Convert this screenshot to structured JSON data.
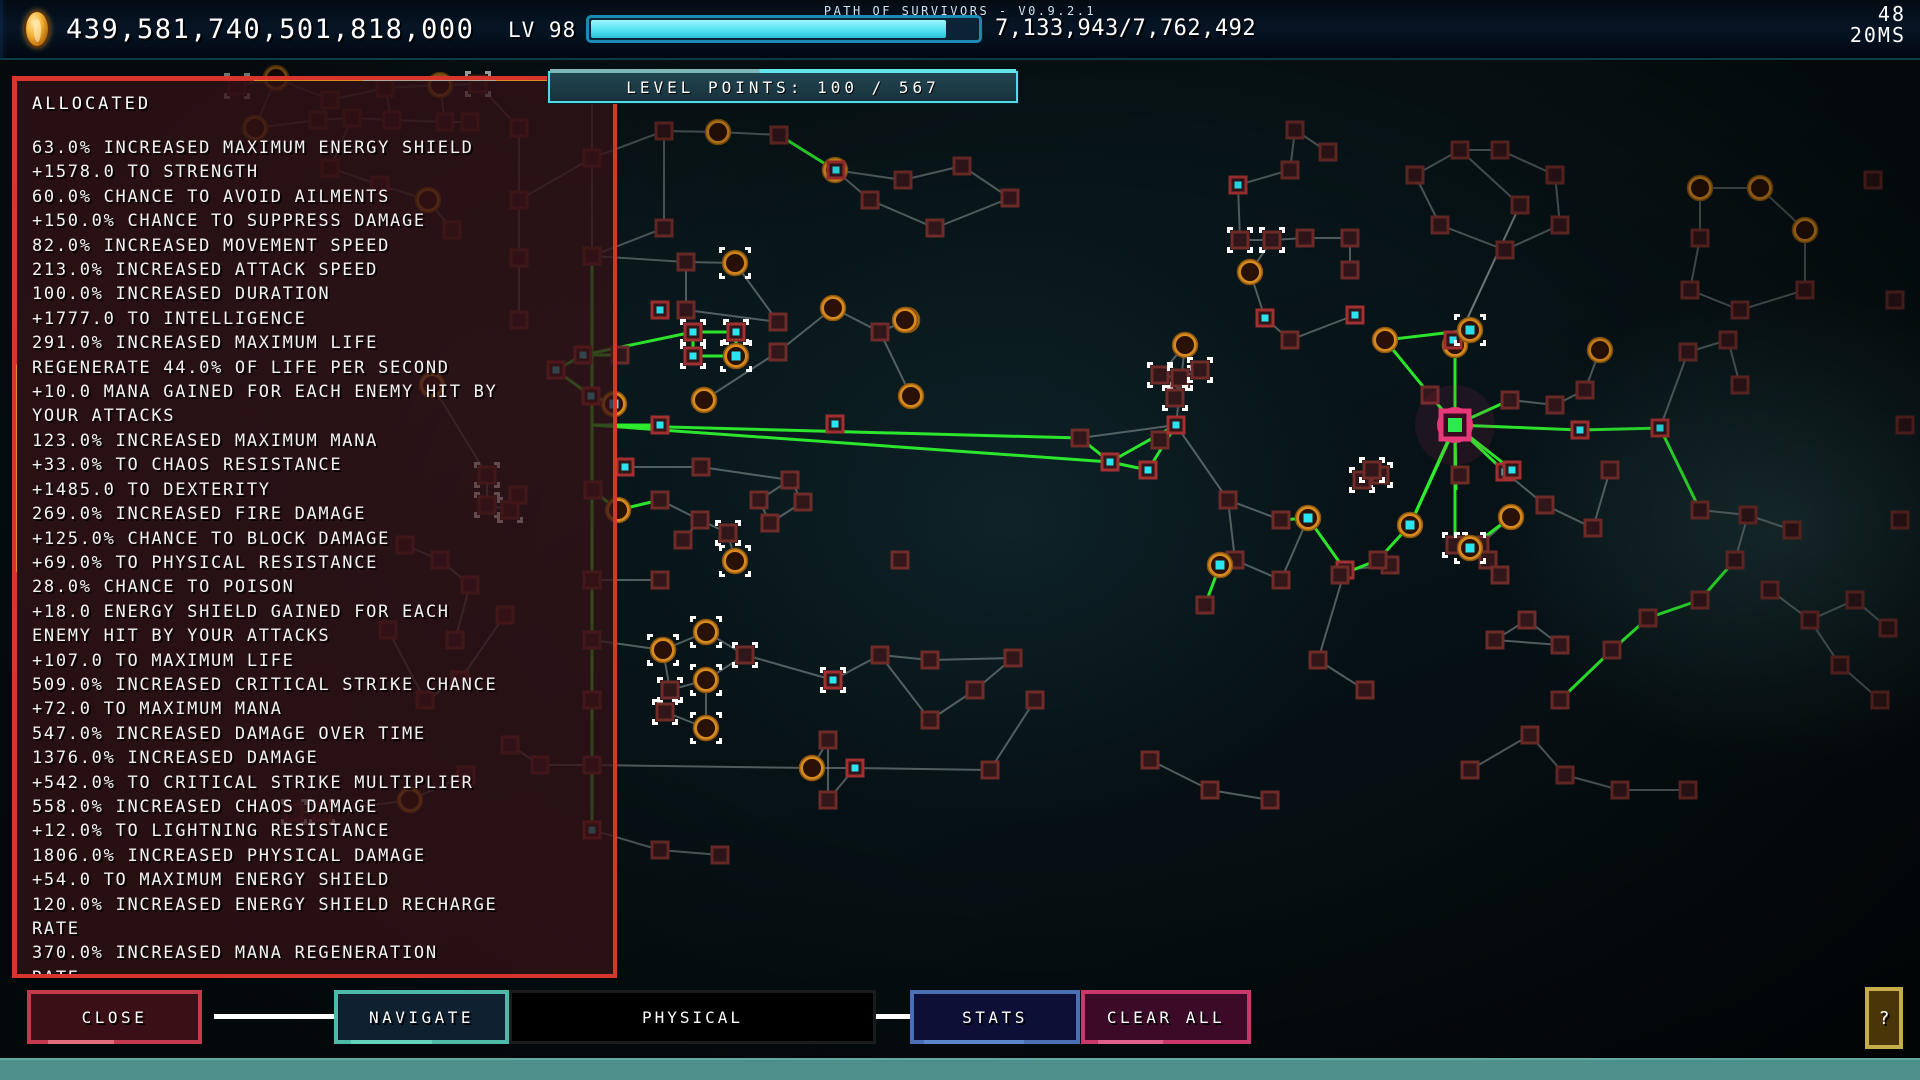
{
  "topbar": {
    "game_title": "PATH OF SURVIVORS - V0.9.2.1",
    "coin_icon": "gold-coin-icon",
    "currency_value": "439,581,740,501,818,000",
    "level_label": "LV 98",
    "xp_current": "7,133,943",
    "xp_max": "7,762,492",
    "xp_text": "7,133,943/7,762,492",
    "xp_percent": 92,
    "fps_value": "48",
    "fps_latency": "20MS"
  },
  "level_points": {
    "text": "LEVEL POINTS: 100 / 567",
    "spent": 100,
    "total": 567
  },
  "allocated_panel": {
    "title": "ALLOCATED",
    "border_color": "#d8352c",
    "stats": [
      "63.0% INCREASED MAXIMUM ENERGY SHIELD",
      "+1578.0 TO STRENGTH",
      "60.0% CHANCE TO AVOID AILMENTS",
      "+150.0% CHANCE TO SUPPRESS DAMAGE",
      "82.0% INCREASED MOVEMENT SPEED",
      "213.0% INCREASED ATTACK SPEED",
      "100.0% INCREASED DURATION",
      "+1777.0 TO INTELLIGENCE",
      "291.0% INCREASED MAXIMUM LIFE",
      "REGENERATE 44.0% OF LIFE PER SECOND",
      "+10.0 MANA GAINED FOR EACH ENEMY HIT BY",
      "YOUR ATTACKS",
      "123.0% INCREASED MAXIMUM MANA",
      "+33.0% TO CHAOS RESISTANCE",
      "+1485.0 TO DEXTERITY",
      "269.0% INCREASED FIRE DAMAGE",
      "+125.0% CHANCE TO BLOCK DAMAGE",
      "+69.0% TO PHYSICAL RESISTANCE",
      "28.0% CHANCE TO POISON",
      "+18.0 ENERGY SHIELD GAINED FOR EACH",
      "ENEMY HIT BY YOUR ATTACKS",
      "+107.0 TO MAXIMUM LIFE",
      "509.0% INCREASED CRITICAL STRIKE CHANCE",
      "+72.0 TO MAXIMUM MANA",
      "547.0% INCREASED DAMAGE OVER TIME",
      "1376.0% INCREASED DAMAGE",
      "+542.0% TO CRITICAL STRIKE MULTIPLIER",
      "558.0% INCREASED CHAOS DAMAGE",
      "+12.0% TO LIGHTNING RESISTANCE",
      "1806.0% INCREASED PHYSICAL DAMAGE",
      "+54.0 TO MAXIMUM ENERGY SHIELD",
      "120.0% INCREASED ENERGY SHIELD RECHARGE",
      "RATE",
      "370.0% INCREASED MANA REGENERATION",
      "RATE"
    ]
  },
  "toolbar": {
    "close_label": "CLOSE",
    "navigate_label": "NAVIGATE",
    "search_value": "PHYSICAL",
    "stats_label": "STATS",
    "clear_all_label": "CLEAR ALL",
    "help_label": "?"
  },
  "colors": {
    "allocated_link": "#2ef02e",
    "unallocated_link": "#8f9a9a",
    "allocated_node_fill": "#2ae4f0",
    "node_frame": "#7a2a28",
    "notable_ring": "#d6891e",
    "highlight_frame": "#ffffff",
    "accent_teal": "#4fd9e4"
  }
}
